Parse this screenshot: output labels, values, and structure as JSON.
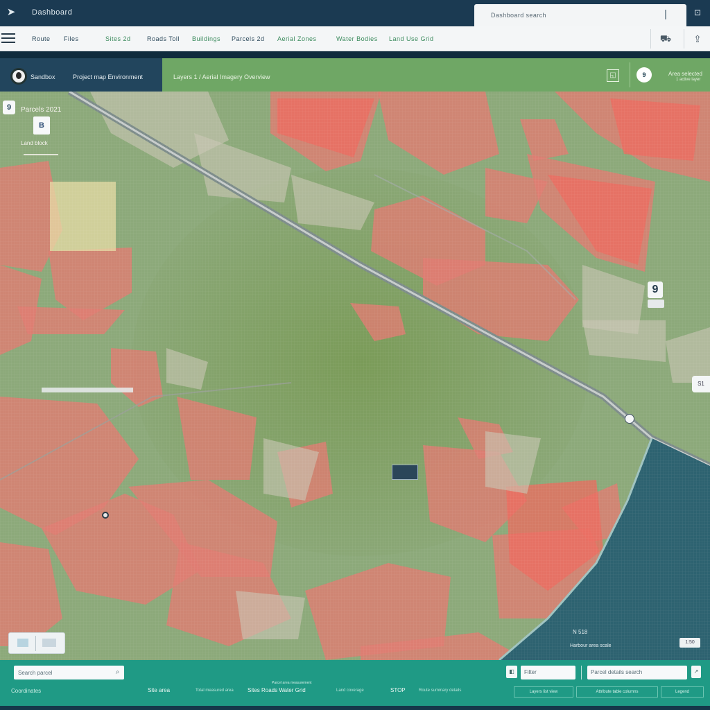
{
  "titlebar": {
    "app_title": "Dashboard",
    "search_tab": "Dashboard search",
    "window_button": "⊡"
  },
  "menu": {
    "items": [
      "Route",
      "Files",
      "Sites 2d",
      "Roads Toll",
      "Buildings",
      "Parcels 2d",
      "Aerial Zones",
      "Water Bodies",
      "Land Use Grid"
    ]
  },
  "panel": {
    "user": "Sandbox",
    "project": "Project map Environment",
    "breadcrumb": "Layers  1  /  Aerial Imagery Overview",
    "locate_label": "9",
    "status": "Area selected",
    "substatus": "1 active layer"
  },
  "map": {
    "layer_badge": "9",
    "layer_title": "Parcels 2021",
    "layer_icon": "B",
    "layer_caption": "Land block",
    "marker": "9",
    "right_tag": "S1",
    "water_label": "N 518",
    "water_sublabel": "Harbour area scale",
    "water_badge": "1:50"
  },
  "bottom": {
    "search_placeholder": "Search parcel",
    "left_label": "Coordinates",
    "top_note": "Parcel area measurement",
    "stats": [
      {
        "main": "Site area",
        "sub": "Total measured area"
      },
      {
        "main": "Sites  Roads  Water  Grid",
        "sub": "Land coverage"
      },
      {
        "main": "STOP",
        "sub": "Route summary details"
      }
    ],
    "chip": "◧",
    "field_1": "Filter",
    "field_2": "Parcel details search",
    "go": "↗",
    "tabs": [
      "Layers list view",
      "Attribute table columns",
      "Legend"
    ]
  },
  "colors": {
    "header_dark": "#1b3a52",
    "panel_green": "#6fa765",
    "bottom_teal": "#1f9a85",
    "water": "#2d6270",
    "parcel_red": "#e47b73",
    "vegetation": "#7fa46b"
  },
  "icons": [
    "navigate-icon",
    "hamburger-icon",
    "car-icon",
    "upload-icon",
    "avatar-icon",
    "square-icon",
    "locate-icon",
    "search-icon"
  ]
}
